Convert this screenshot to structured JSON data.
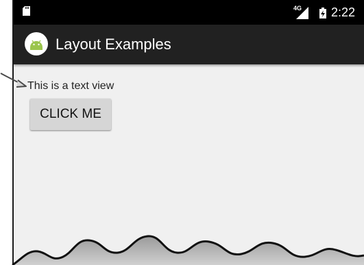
{
  "status_bar": {
    "network": "4G",
    "time": "2:22",
    "icons": [
      "sd-card-icon",
      "signal-icon",
      "battery-charging-icon"
    ]
  },
  "app_bar": {
    "title": "Layout Examples",
    "icon": "android-icon",
    "color": "#212121"
  },
  "content": {
    "text_view": "This is a text view",
    "button_label": "CLICK ME",
    "background": "#f0f0f0"
  }
}
